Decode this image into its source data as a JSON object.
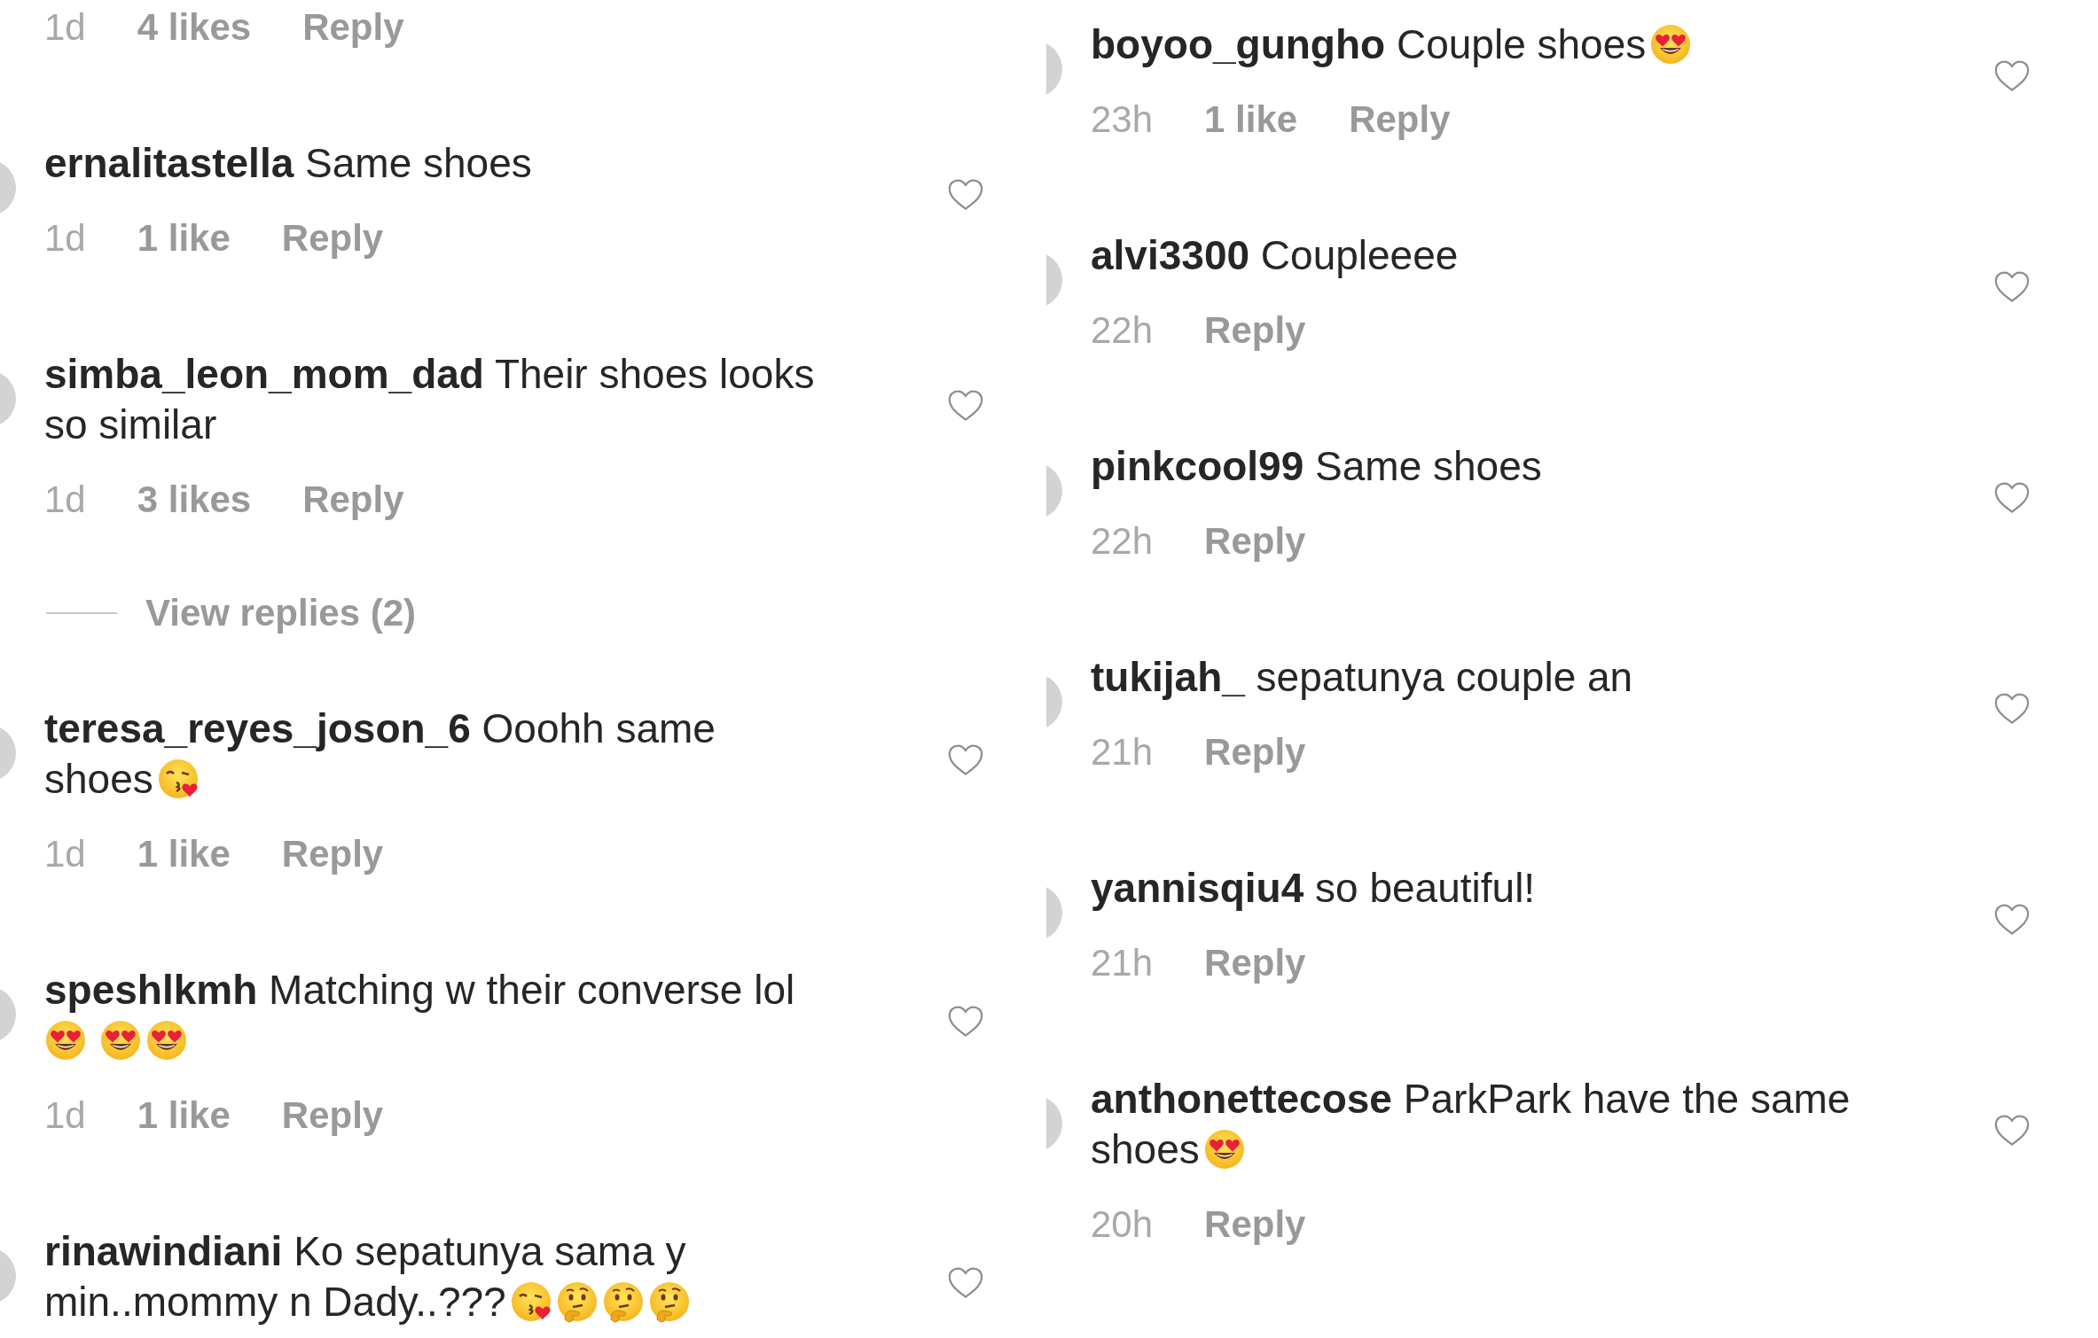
{
  "columns": [
    {
      "comments": [
        {
          "time": "1d",
          "likes": "4 likes",
          "reply": "Reply"
        },
        {
          "lines": [
            {
              "text": "**ernalitastella** Same shoes"
            }
          ],
          "time": "1d",
          "likes": "1 like",
          "reply": "Reply"
        },
        {
          "lines": [
            {
              "text": "**simba_leon_mom_dad** Their shoes looks"
            },
            {
              "text": "so similar"
            }
          ],
          "time": "1d",
          "likes": "3 likes",
          "reply": "Reply",
          "view_replies": "View replies (2)"
        },
        {
          "lines": [
            {
              "text": "**teresa_reyes_joson_6** Ooohh same"
            },
            {
              "text": "shoes",
              "emoji": [
                {
                  "kind": "kiss_heart"
                }
              ]
            }
          ],
          "time": "1d",
          "likes": "1 like",
          "reply": "Reply"
        },
        {
          "lines": [
            {
              "text": "**speshlkmh** Matching w their converse lol"
            },
            {
              "emoji": [
                {
                  "kind": "heart_eyes"
                },
                {
                  "kind": "heart_eyes"
                },
                {
                  "kind": "heart_eyes"
                }
              ]
            }
          ],
          "time": "1d",
          "likes": "1 like",
          "reply": "Reply"
        },
        {
          "lines": [
            {
              "text": "**rinawindiani** Ko sepatunya sama y"
            },
            {
              "text": "min..mommy n Dady..???",
              "emoji": [
                {
                  "kind": "kiss_heart"
                },
                {
                  "kind": "thinking"
                },
                {
                  "kind": "thinking"
                },
                {
                  "kind": "thinking"
                }
              ]
            }
          ]
        }
      ]
    },
    {
      "comments": [
        {
          "lines": [
            {
              "text": "**boyoo_gungho** Couple shoes",
              "emoji": [
                {
                  "kind": "heart_eyes"
                }
              ]
            }
          ],
          "time": "23h",
          "likes": "1 like",
          "reply": "Reply"
        },
        {
          "lines": [
            {
              "text": "**alvi3300** Coupleeee"
            }
          ],
          "time": "22h",
          "reply": "Reply"
        },
        {
          "lines": [
            {
              "text": "**pinkcool99** Same shoes"
            }
          ],
          "time": "22h",
          "reply": "Reply"
        },
        {
          "lines": [
            {
              "text": "**tukijah_** sepatunya couple an"
            }
          ],
          "time": "21h",
          "reply": "Reply"
        },
        {
          "lines": [
            {
              "text": "**yannisqiu4** so beautiful!"
            }
          ],
          "time": "21h",
          "reply": "Reply"
        },
        {
          "lines": [
            {
              "text": "**anthonettecose** ParkPark have the same"
            },
            {
              "text": "shoes",
              "emoji": [
                {
                  "kind": "heart_eyes"
                }
              ]
            }
          ],
          "time": "20h",
          "reply": "Reply"
        }
      ]
    }
  ]
}
